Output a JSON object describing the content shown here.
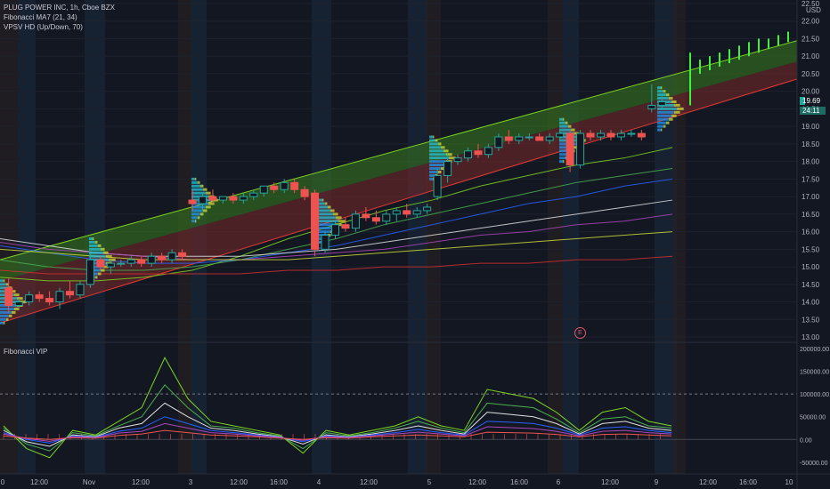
{
  "header": {
    "symbol_line": "PLUG POWER INC, 1h, Cboe BZX",
    "indicators": [
      "Fibonacci MA7 (21, 34)",
      "VPSV HD (Up/Down, 70)"
    ],
    "lower_pane_title": "Fibonacci VIP"
  },
  "axis": {
    "currency": "USD",
    "price_ticks": [
      "22.50",
      "22.00",
      "21.50",
      "21.00",
      "20.50",
      "20.00",
      "19.50",
      "19.00",
      "18.50",
      "18.00",
      "17.50",
      "17.00",
      "16.50",
      "16.00",
      "15.50",
      "15.00",
      "14.50",
      "14.00",
      "13.50",
      "13.00"
    ],
    "volume_ticks": [
      "200000.00",
      "150000.00",
      "100000.00",
      "50000.00",
      "0.00",
      "-50000.00"
    ],
    "time_ticks": [
      "0",
      "12:00",
      "Nov",
      "12:00",
      "3",
      "12:00",
      "16:00",
      "4",
      "12:00",
      "5",
      "12:00",
      "16:00",
      "6",
      "12:00",
      "9",
      "12:00",
      "16:00",
      "10"
    ]
  },
  "price_tags": {
    "last_price": "19.69",
    "countdown": "24:11"
  },
  "earnings_badge": "E",
  "colors": {
    "background": "#131722",
    "up": "#26a69a",
    "down": "#ef5350",
    "channel_upper_fill": "#3a7d1e",
    "channel_lower_fill": "#7a2a2a",
    "channel_top_line": "#7ed321",
    "channel_bottom_line": "#e53935",
    "projection": "#3cf23c"
  },
  "chart_data": {
    "type": "candlestick",
    "title": "PLUG POWER INC, 1h, Cboe BZX",
    "ylim": [
      12.9,
      22.6
    ],
    "candles": [
      {
        "o": 14.4,
        "h": 14.7,
        "l": 13.7,
        "c": 13.9
      },
      {
        "o": 13.9,
        "h": 14.1,
        "l": 13.8,
        "c": 14.0
      },
      {
        "o": 14.0,
        "h": 14.3,
        "l": 13.9,
        "c": 14.2
      },
      {
        "o": 14.2,
        "h": 14.3,
        "l": 14.0,
        "c": 14.1
      },
      {
        "o": 14.1,
        "h": 14.3,
        "l": 13.9,
        "c": 14.0
      },
      {
        "o": 14.0,
        "h": 14.4,
        "l": 13.8,
        "c": 14.3
      },
      {
        "o": 14.3,
        "h": 14.6,
        "l": 14.1,
        "c": 14.2
      },
      {
        "o": 14.2,
        "h": 14.6,
        "l": 14.1,
        "c": 14.5
      },
      {
        "o": 14.5,
        "h": 15.4,
        "l": 14.4,
        "c": 15.2
      },
      {
        "o": 15.2,
        "h": 15.3,
        "l": 14.9,
        "c": 15.0
      },
      {
        "o": 15.0,
        "h": 15.2,
        "l": 14.8,
        "c": 15.1
      },
      {
        "o": 15.1,
        "h": 15.2,
        "l": 15.0,
        "c": 15.1
      },
      {
        "o": 15.1,
        "h": 15.3,
        "l": 15.0,
        "c": 15.2
      },
      {
        "o": 15.2,
        "h": 15.3,
        "l": 15.0,
        "c": 15.1
      },
      {
        "o": 15.1,
        "h": 15.4,
        "l": 15.0,
        "c": 15.3
      },
      {
        "o": 15.3,
        "h": 15.4,
        "l": 15.1,
        "c": 15.2
      },
      {
        "o": 15.2,
        "h": 15.5,
        "l": 15.1,
        "c": 15.4
      },
      {
        "o": 15.4,
        "h": 15.5,
        "l": 15.2,
        "c": 15.3
      },
      {
        "o": 16.9,
        "h": 17.2,
        "l": 16.6,
        "c": 16.8
      },
      {
        "o": 16.8,
        "h": 17.1,
        "l": 16.6,
        "c": 17.0
      },
      {
        "o": 17.0,
        "h": 17.2,
        "l": 16.8,
        "c": 16.9
      },
      {
        "o": 16.9,
        "h": 17.0,
        "l": 16.8,
        "c": 17.0
      },
      {
        "o": 17.0,
        "h": 17.1,
        "l": 16.8,
        "c": 16.9
      },
      {
        "o": 16.9,
        "h": 17.1,
        "l": 16.8,
        "c": 17.0
      },
      {
        "o": 17.0,
        "h": 17.2,
        "l": 16.9,
        "c": 17.1
      },
      {
        "o": 17.1,
        "h": 17.3,
        "l": 17.0,
        "c": 17.3
      },
      {
        "o": 17.3,
        "h": 17.4,
        "l": 17.1,
        "c": 17.2
      },
      {
        "o": 17.2,
        "h": 17.5,
        "l": 17.1,
        "c": 17.4
      },
      {
        "o": 17.4,
        "h": 17.5,
        "l": 17.1,
        "c": 17.2
      },
      {
        "o": 17.2,
        "h": 17.3,
        "l": 16.9,
        "c": 17.0
      },
      {
        "o": 17.1,
        "h": 17.2,
        "l": 15.3,
        "c": 15.5
      },
      {
        "o": 15.5,
        "h": 16.0,
        "l": 15.4,
        "c": 15.9
      },
      {
        "o": 15.9,
        "h": 16.3,
        "l": 15.8,
        "c": 16.2
      },
      {
        "o": 16.2,
        "h": 16.4,
        "l": 16.0,
        "c": 16.1
      },
      {
        "o": 16.1,
        "h": 16.6,
        "l": 16.0,
        "c": 16.5
      },
      {
        "o": 16.5,
        "h": 16.7,
        "l": 16.3,
        "c": 16.4
      },
      {
        "o": 16.4,
        "h": 16.6,
        "l": 16.2,
        "c": 16.3
      },
      {
        "o": 16.3,
        "h": 16.6,
        "l": 16.2,
        "c": 16.5
      },
      {
        "o": 16.5,
        "h": 16.7,
        "l": 16.3,
        "c": 16.6
      },
      {
        "o": 16.6,
        "h": 16.8,
        "l": 16.4,
        "c": 16.5
      },
      {
        "o": 16.5,
        "h": 16.7,
        "l": 16.4,
        "c": 16.6
      },
      {
        "o": 16.6,
        "h": 16.8,
        "l": 16.5,
        "c": 16.7
      },
      {
        "o": 17.0,
        "h": 17.8,
        "l": 16.9,
        "c": 17.6
      },
      {
        "o": 17.6,
        "h": 18.2,
        "l": 17.4,
        "c": 18.0
      },
      {
        "o": 18.0,
        "h": 18.2,
        "l": 17.9,
        "c": 18.1
      },
      {
        "o": 18.1,
        "h": 18.4,
        "l": 18.0,
        "c": 18.3
      },
      {
        "o": 18.3,
        "h": 18.5,
        "l": 18.1,
        "c": 18.2
      },
      {
        "o": 18.2,
        "h": 18.5,
        "l": 18.1,
        "c": 18.4
      },
      {
        "o": 18.4,
        "h": 18.8,
        "l": 18.3,
        "c": 18.7
      },
      {
        "o": 18.7,
        "h": 18.9,
        "l": 18.5,
        "c": 18.6
      },
      {
        "o": 18.6,
        "h": 18.8,
        "l": 18.5,
        "c": 18.7
      },
      {
        "o": 18.7,
        "h": 18.8,
        "l": 18.6,
        "c": 18.7
      },
      {
        "o": 18.7,
        "h": 18.8,
        "l": 18.6,
        "c": 18.6
      },
      {
        "o": 18.6,
        "h": 18.8,
        "l": 18.5,
        "c": 18.7
      },
      {
        "o": 18.7,
        "h": 18.9,
        "l": 18.6,
        "c": 18.8
      },
      {
        "o": 18.8,
        "h": 18.9,
        "l": 17.7,
        "c": 17.9
      },
      {
        "o": 17.9,
        "h": 18.9,
        "l": 17.8,
        "c": 18.8
      },
      {
        "o": 18.8,
        "h": 18.9,
        "l": 18.6,
        "c": 18.7
      },
      {
        "o": 18.7,
        "h": 18.9,
        "l": 18.6,
        "c": 18.8
      },
      {
        "o": 18.8,
        "h": 18.9,
        "l": 18.6,
        "c": 18.7
      },
      {
        "o": 18.7,
        "h": 18.9,
        "l": 18.6,
        "c": 18.8
      },
      {
        "o": 18.8,
        "h": 18.9,
        "l": 18.7,
        "c": 18.8
      },
      {
        "o": 18.8,
        "h": 18.9,
        "l": 18.6,
        "c": 18.7
      },
      {
        "o": 19.5,
        "h": 20.2,
        "l": 19.4,
        "c": 19.6
      },
      {
        "o": 19.6,
        "h": 19.9,
        "l": 19.5,
        "c": 19.7
      }
    ],
    "channel": {
      "upper_start": 15.2,
      "upper_end": 20.5,
      "mid_start": 14.6,
      "mid_end": 19.9,
      "lower_start": 13.4,
      "lower_end": 19.3
    },
    "moving_averages": [
      {
        "color": "#7ed321",
        "values": [
          14.7,
          14.6,
          14.6,
          14.7,
          14.9,
          15.3,
          15.8,
          16.2,
          16.6,
          16.9,
          17.3,
          17.6,
          17.9,
          18.1,
          18.4
        ]
      },
      {
        "color": "#4caf50",
        "values": [
          15.2,
          15.0,
          14.9,
          14.9,
          15.0,
          15.2,
          15.5,
          15.8,
          16.2,
          16.5,
          16.8,
          17.1,
          17.4,
          17.6,
          17.8
        ]
      },
      {
        "color": "#2962ff",
        "values": [
          15.6,
          15.4,
          15.2,
          15.1,
          15.1,
          15.2,
          15.4,
          15.6,
          15.9,
          16.2,
          16.5,
          16.8,
          17.0,
          17.3,
          17.5
        ]
      },
      {
        "color": "#e0e0e0",
        "values": [
          15.8,
          15.6,
          15.4,
          15.3,
          15.3,
          15.3,
          15.4,
          15.5,
          15.7,
          15.9,
          16.1,
          16.3,
          16.5,
          16.7,
          16.9
        ]
      },
      {
        "color": "#ab47bc",
        "values": [
          15.7,
          15.5,
          15.4,
          15.3,
          15.2,
          15.2,
          15.3,
          15.4,
          15.5,
          15.7,
          15.9,
          16.0,
          16.2,
          16.3,
          16.5
        ]
      },
      {
        "color": "#cddc39",
        "values": [
          15.5,
          15.4,
          15.3,
          15.2,
          15.2,
          15.2,
          15.2,
          15.3,
          15.4,
          15.5,
          15.6,
          15.7,
          15.8,
          15.9,
          16.0
        ]
      },
      {
        "color": "#d32f2f",
        "values": [
          14.9,
          14.8,
          14.8,
          14.8,
          14.8,
          14.8,
          14.9,
          14.9,
          15.0,
          15.0,
          15.1,
          15.1,
          15.2,
          15.2,
          15.3
        ]
      }
    ],
    "projection_bars": [
      {
        "lo": 19.6,
        "hi": 21.1
      },
      {
        "lo": 20.5,
        "hi": 20.9
      },
      {
        "lo": 20.6,
        "hi": 21.0
      },
      {
        "lo": 20.7,
        "hi": 21.1
      },
      {
        "lo": 20.8,
        "hi": 21.2
      },
      {
        "lo": 20.9,
        "hi": 21.3
      },
      {
        "lo": 21.0,
        "hi": 21.4
      },
      {
        "lo": 21.1,
        "hi": 21.5
      },
      {
        "lo": 21.2,
        "hi": 21.5
      },
      {
        "lo": 21.3,
        "hi": 21.6
      },
      {
        "lo": 21.4,
        "hi": 21.7
      }
    ],
    "volume_oscillator": {
      "ylim": [
        -60000,
        200000
      ],
      "reference_line": 100000,
      "series": [
        {
          "color": "#7ed321",
          "values": [
            30000,
            -20000,
            -40000,
            20000,
            10000,
            40000,
            70000,
            180000,
            90000,
            40000,
            30000,
            20000,
            10000,
            -30000,
            20000,
            10000,
            20000,
            30000,
            50000,
            30000,
            20000,
            110000,
            100000,
            90000,
            60000,
            20000,
            60000,
            70000,
            40000,
            30000
          ]
        },
        {
          "color": "#4caf50",
          "values": [
            25000,
            -10000,
            -25000,
            15000,
            8000,
            30000,
            50000,
            120000,
            70000,
            30000,
            25000,
            15000,
            8000,
            -20000,
            15000,
            8000,
            15000,
            25000,
            40000,
            25000,
            15000,
            80000,
            75000,
            70000,
            45000,
            15000,
            45000,
            50000,
            30000,
            25000
          ]
        },
        {
          "color": "#e0e0e0",
          "values": [
            20000,
            -5000,
            -15000,
            10000,
            6000,
            25000,
            35000,
            80000,
            50000,
            25000,
            20000,
            12000,
            6000,
            -10000,
            10000,
            6000,
            12000,
            20000,
            30000,
            20000,
            12000,
            60000,
            55000,
            50000,
            35000,
            12000,
            35000,
            40000,
            25000,
            20000
          ]
        },
        {
          "color": "#2962ff",
          "values": [
            15000,
            0,
            -8000,
            8000,
            5000,
            18000,
            25000,
            50000,
            35000,
            20000,
            15000,
            10000,
            5000,
            -5000,
            8000,
            5000,
            10000,
            15000,
            22000,
            15000,
            10000,
            40000,
            38000,
            35000,
            25000,
            10000,
            25000,
            28000,
            20000,
            15000
          ]
        },
        {
          "color": "#ab47bc",
          "values": [
            12000,
            2000,
            -4000,
            6000,
            4000,
            14000,
            18000,
            35000,
            25000,
            15000,
            12000,
            8000,
            4000,
            -2000,
            6000,
            4000,
            8000,
            12000,
            16000,
            12000,
            8000,
            28000,
            26000,
            24000,
            18000,
            8000,
            18000,
            20000,
            15000,
            12000
          ]
        },
        {
          "color": "#ef5350",
          "values": [
            8000,
            3000,
            0,
            4000,
            3000,
            9000,
            12000,
            20000,
            15000,
            10000,
            8000,
            6000,
            3000,
            0,
            4000,
            3000,
            6000,
            8000,
            10000,
            8000,
            6000,
            16000,
            15000,
            14000,
            11000,
            6000,
            11000,
            12000,
            10000,
            8000
          ]
        }
      ]
    }
  }
}
